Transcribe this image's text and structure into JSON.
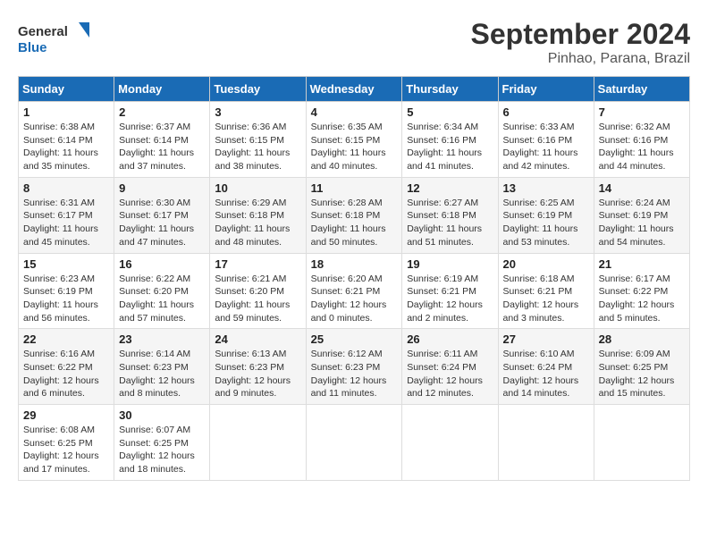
{
  "header": {
    "logo_general": "General",
    "logo_blue": "Blue",
    "month_year": "September 2024",
    "location": "Pinhao, Parana, Brazil"
  },
  "weekdays": [
    "Sunday",
    "Monday",
    "Tuesday",
    "Wednesday",
    "Thursday",
    "Friday",
    "Saturday"
  ],
  "weeks": [
    [
      {
        "day": "1",
        "sunrise": "6:38 AM",
        "sunset": "6:14 PM",
        "daylight": "11 hours and 35 minutes."
      },
      {
        "day": "2",
        "sunrise": "6:37 AM",
        "sunset": "6:14 PM",
        "daylight": "11 hours and 37 minutes."
      },
      {
        "day": "3",
        "sunrise": "6:36 AM",
        "sunset": "6:15 PM",
        "daylight": "11 hours and 38 minutes."
      },
      {
        "day": "4",
        "sunrise": "6:35 AM",
        "sunset": "6:15 PM",
        "daylight": "11 hours and 40 minutes."
      },
      {
        "day": "5",
        "sunrise": "6:34 AM",
        "sunset": "6:16 PM",
        "daylight": "11 hours and 41 minutes."
      },
      {
        "day": "6",
        "sunrise": "6:33 AM",
        "sunset": "6:16 PM",
        "daylight": "11 hours and 42 minutes."
      },
      {
        "day": "7",
        "sunrise": "6:32 AM",
        "sunset": "6:16 PM",
        "daylight": "11 hours and 44 minutes."
      }
    ],
    [
      {
        "day": "8",
        "sunrise": "6:31 AM",
        "sunset": "6:17 PM",
        "daylight": "11 hours and 45 minutes."
      },
      {
        "day": "9",
        "sunrise": "6:30 AM",
        "sunset": "6:17 PM",
        "daylight": "11 hours and 47 minutes."
      },
      {
        "day": "10",
        "sunrise": "6:29 AM",
        "sunset": "6:18 PM",
        "daylight": "11 hours and 48 minutes."
      },
      {
        "day": "11",
        "sunrise": "6:28 AM",
        "sunset": "6:18 PM",
        "daylight": "11 hours and 50 minutes."
      },
      {
        "day": "12",
        "sunrise": "6:27 AM",
        "sunset": "6:18 PM",
        "daylight": "11 hours and 51 minutes."
      },
      {
        "day": "13",
        "sunrise": "6:25 AM",
        "sunset": "6:19 PM",
        "daylight": "11 hours and 53 minutes."
      },
      {
        "day": "14",
        "sunrise": "6:24 AM",
        "sunset": "6:19 PM",
        "daylight": "11 hours and 54 minutes."
      }
    ],
    [
      {
        "day": "15",
        "sunrise": "6:23 AM",
        "sunset": "6:19 PM",
        "daylight": "11 hours and 56 minutes."
      },
      {
        "day": "16",
        "sunrise": "6:22 AM",
        "sunset": "6:20 PM",
        "daylight": "11 hours and 57 minutes."
      },
      {
        "day": "17",
        "sunrise": "6:21 AM",
        "sunset": "6:20 PM",
        "daylight": "11 hours and 59 minutes."
      },
      {
        "day": "18",
        "sunrise": "6:20 AM",
        "sunset": "6:21 PM",
        "daylight": "12 hours and 0 minutes."
      },
      {
        "day": "19",
        "sunrise": "6:19 AM",
        "sunset": "6:21 PM",
        "daylight": "12 hours and 2 minutes."
      },
      {
        "day": "20",
        "sunrise": "6:18 AM",
        "sunset": "6:21 PM",
        "daylight": "12 hours and 3 minutes."
      },
      {
        "day": "21",
        "sunrise": "6:17 AM",
        "sunset": "6:22 PM",
        "daylight": "12 hours and 5 minutes."
      }
    ],
    [
      {
        "day": "22",
        "sunrise": "6:16 AM",
        "sunset": "6:22 PM",
        "daylight": "12 hours and 6 minutes."
      },
      {
        "day": "23",
        "sunrise": "6:14 AM",
        "sunset": "6:23 PM",
        "daylight": "12 hours and 8 minutes."
      },
      {
        "day": "24",
        "sunrise": "6:13 AM",
        "sunset": "6:23 PM",
        "daylight": "12 hours and 9 minutes."
      },
      {
        "day": "25",
        "sunrise": "6:12 AM",
        "sunset": "6:23 PM",
        "daylight": "12 hours and 11 minutes."
      },
      {
        "day": "26",
        "sunrise": "6:11 AM",
        "sunset": "6:24 PM",
        "daylight": "12 hours and 12 minutes."
      },
      {
        "day": "27",
        "sunrise": "6:10 AM",
        "sunset": "6:24 PM",
        "daylight": "12 hours and 14 minutes."
      },
      {
        "day": "28",
        "sunrise": "6:09 AM",
        "sunset": "6:25 PM",
        "daylight": "12 hours and 15 minutes."
      }
    ],
    [
      {
        "day": "29",
        "sunrise": "6:08 AM",
        "sunset": "6:25 PM",
        "daylight": "12 hours and 17 minutes."
      },
      {
        "day": "30",
        "sunrise": "6:07 AM",
        "sunset": "6:25 PM",
        "daylight": "12 hours and 18 minutes."
      },
      null,
      null,
      null,
      null,
      null
    ]
  ],
  "labels": {
    "sunrise": "Sunrise:",
    "sunset": "Sunset:",
    "daylight": "Daylight:"
  }
}
